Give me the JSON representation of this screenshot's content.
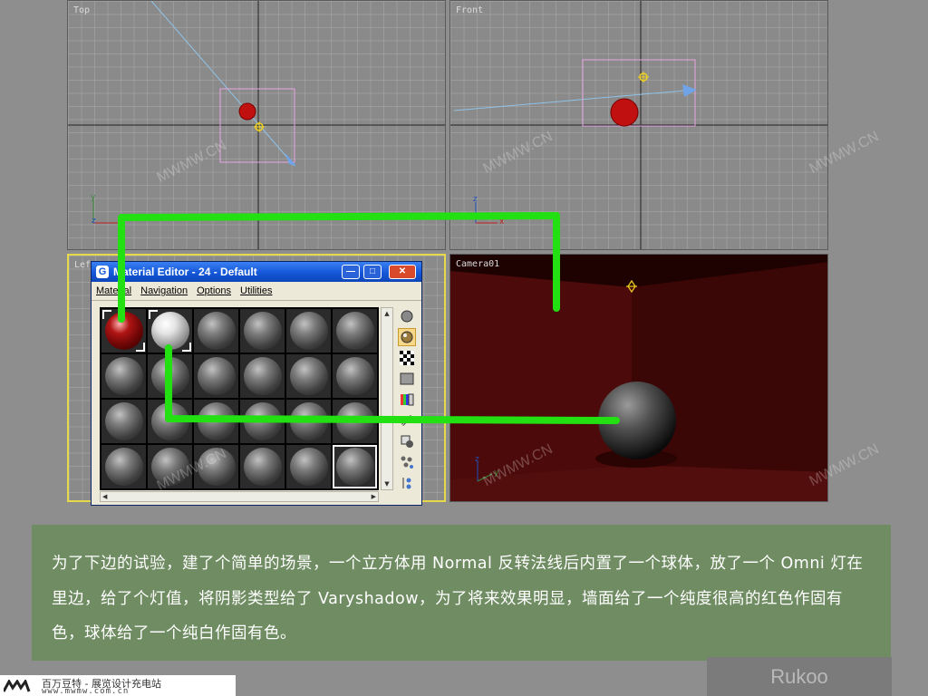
{
  "viewports": {
    "top": {
      "label": "Top"
    },
    "front": {
      "label": "Front"
    },
    "left": {
      "label": "Left"
    },
    "camera": {
      "label": "Camera01"
    }
  },
  "axes": {
    "x": "x",
    "y": "y",
    "z": "z"
  },
  "material_editor": {
    "title": "Material Editor - 24 - Default",
    "logo": "G",
    "minimize": "—",
    "maximize": "□",
    "close": "✕",
    "menu": [
      "Material",
      "Navigation",
      "Options",
      "Utilities"
    ],
    "slot_rows": 4,
    "slot_cols": 6,
    "red_slot_color": "#8b0a0a",
    "white_slot_color": "#f0f0f0",
    "tool_icons": [
      "sample-type-icon",
      "backlight-icon",
      "background-checker-icon",
      "sample-uv-tiling-icon",
      "video-color-check-icon",
      "make-preview-icon",
      "options-icon",
      "select-by-material-icon",
      "material-navigator-icon"
    ]
  },
  "caption": {
    "text": "为了下边的试验，建了个简单的场景，一个立方体用 Normal 反转法线后内置了一个球体，放了一个 Omni 灯在里边，给了个灯值，将阴影类型给了 Varyshadow，为了将来效果明显，墙面给了一个纯度很高的红色作固有色，球体给了一个纯白作固有色。"
  },
  "watermark": {
    "brand": "MWMW.CN"
  },
  "corner": {
    "text": "Rukoo"
  },
  "footer": {
    "text": "百万豆特 - 展览设计充电站",
    "url": "www.mwmw.com.cn"
  },
  "colors": {
    "highlight": "#22e012",
    "camera_bg": "#3b0707",
    "caption_bg": "#6f8c62",
    "active_viewport": "#e8d94a"
  }
}
